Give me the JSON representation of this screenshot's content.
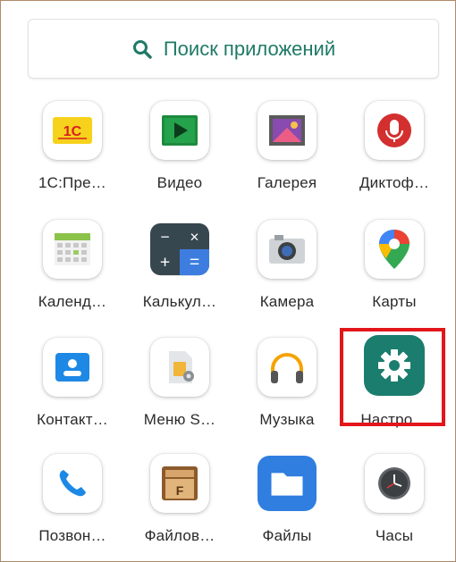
{
  "search": {
    "placeholder": "Поиск приложений",
    "icon": "search-icon"
  },
  "apps": [
    {
      "label": "1С:Пре…",
      "icon": "1c-icon"
    },
    {
      "label": "Видео",
      "icon": "video-play-icon"
    },
    {
      "label": "Галерея",
      "icon": "gallery-icon"
    },
    {
      "label": "Диктоф…",
      "icon": "microphone-icon"
    },
    {
      "label": "Календ…",
      "icon": "calendar-icon"
    },
    {
      "label": "Калькул…",
      "icon": "calculator-icon"
    },
    {
      "label": "Камера",
      "icon": "camera-icon"
    },
    {
      "label": "Карты",
      "icon": "maps-pin-icon"
    },
    {
      "label": "Контакт…",
      "icon": "contacts-icon"
    },
    {
      "label": "Меню S…",
      "icon": "sim-menu-icon"
    },
    {
      "label": "Музыка",
      "icon": "headphones-icon"
    },
    {
      "label": "Настро…",
      "icon": "settings-gear-icon"
    },
    {
      "label": "Позвон…",
      "icon": "phone-icon"
    },
    {
      "label": "Файлов…",
      "icon": "file-manager-icon"
    },
    {
      "label": "Файлы",
      "icon": "folder-icon"
    },
    {
      "label": "Часы",
      "icon": "clock-icon"
    }
  ],
  "colors": {
    "accent": "#1f7a66",
    "settings": "#1b7d6d",
    "highlight": "#e2161b"
  }
}
